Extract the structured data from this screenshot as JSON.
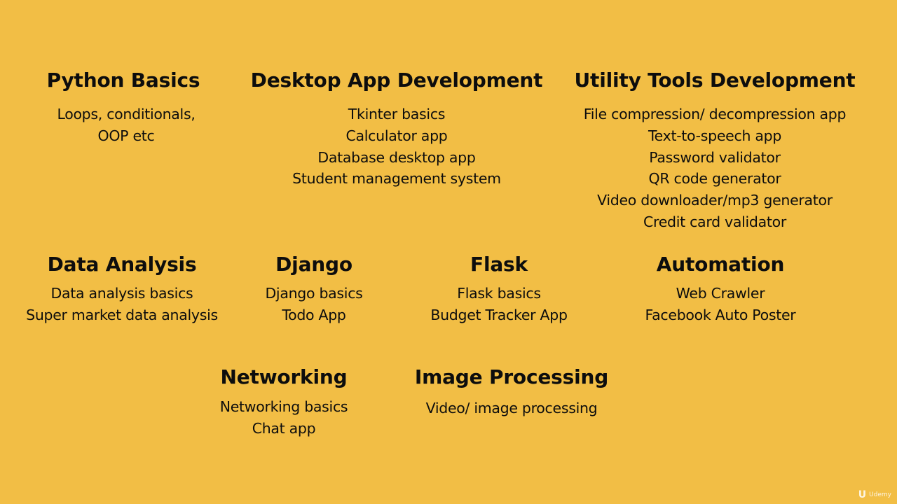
{
  "colors": {
    "background": "#f2be45",
    "text": "#0d0d0d"
  },
  "topics": {
    "python_basics": {
      "title": "Python Basics",
      "items": [
        "Loops, conditionals,",
        "OOP etc"
      ]
    },
    "desktop_app": {
      "title": "Desktop App Development",
      "items": [
        "Tkinter basics",
        "Calculator app",
        "Database desktop app",
        "Student management system"
      ]
    },
    "utility_tools": {
      "title": "Utility Tools Development",
      "items": [
        "File compression/ decompression app",
        "Text-to-speech app",
        "Password validator",
        "QR code generator",
        "Video downloader/mp3 generator",
        "Credit card validator"
      ]
    },
    "data_analysis": {
      "title": "Data Analysis",
      "items": [
        "Data analysis basics",
        "Super market data analysis"
      ]
    },
    "django": {
      "title": "Django",
      "items": [
        "Django basics",
        "Todo App"
      ]
    },
    "flask": {
      "title": "Flask",
      "items": [
        "Flask basics",
        "Budget Tracker App"
      ]
    },
    "automation": {
      "title": "Automation",
      "items": [
        "Web Crawler",
        "Facebook Auto Poster"
      ]
    },
    "networking": {
      "title": "Networking",
      "items": [
        "Networking basics",
        "Chat app"
      ]
    },
    "image_processing": {
      "title": "Image Processing",
      "items": [
        "Video/  image processing"
      ]
    }
  },
  "watermark": {
    "icon": "udemy-logo-icon",
    "mark": "U",
    "text": "Udemy"
  }
}
